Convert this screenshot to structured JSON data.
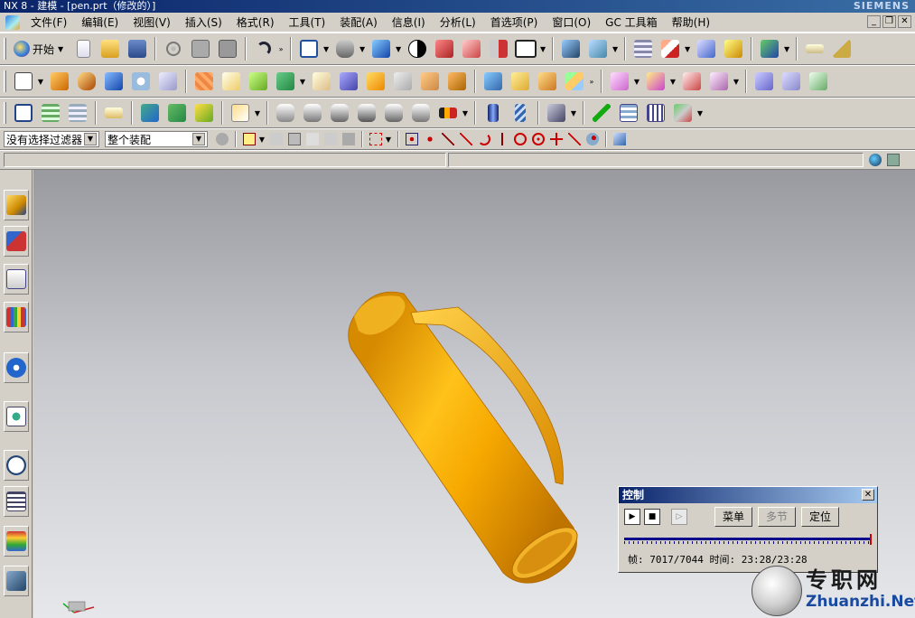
{
  "window": {
    "title": "NX 8 - 建模 - [pen.prt（修改的）]",
    "brand": "SIEMENS"
  },
  "menu": [
    "文件(F)",
    "编辑(E)",
    "视图(V)",
    "插入(S)",
    "格式(R)",
    "工具(T)",
    "装配(A)",
    "信息(I)",
    "分析(L)",
    "首选项(P)",
    "窗口(O)",
    "GC 工具箱",
    "帮助(H)"
  ],
  "toolbar": {
    "start_label": "开始"
  },
  "selection_bar": {
    "filter_value": "没有选择过滤器",
    "scope_value": "整个装配"
  },
  "control_dialog": {
    "title": "控制",
    "menu_button": "菜单",
    "segment_button": "多节",
    "position_button": "定位",
    "status": "帧: 7017/7044 时间: 23:28/23:28"
  },
  "watermark": {
    "cn": "专职网",
    "en": "Zhuanzhi.Net"
  },
  "colors": {
    "part": "#f5a800",
    "titlebar": "#0a246a",
    "viewport_top": "#999aa0",
    "viewport_bottom": "#e6e7ea"
  }
}
